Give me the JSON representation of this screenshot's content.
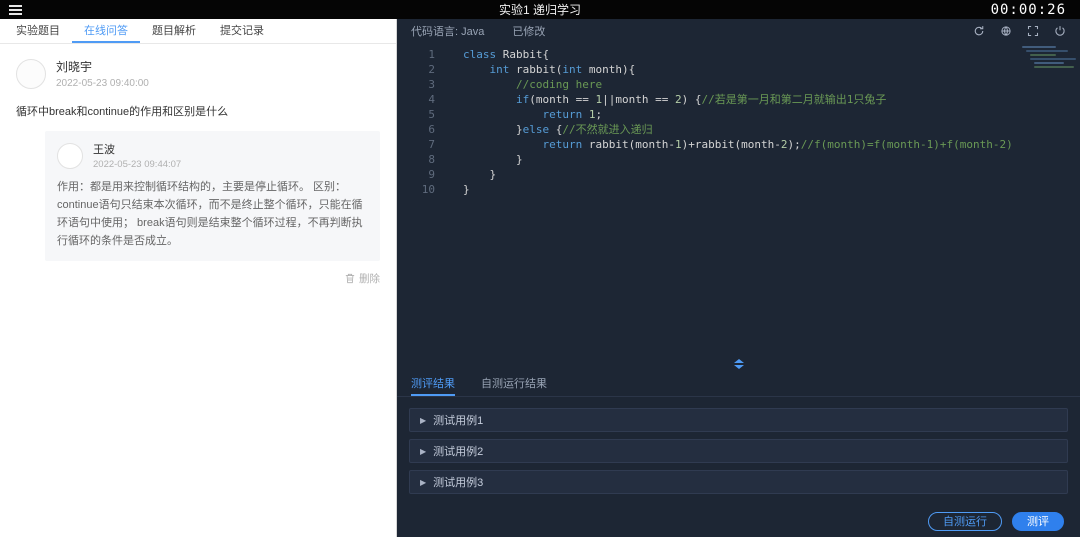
{
  "colors": {
    "accent": "#4f9bf5",
    "keyword": "#569cd6",
    "plain": "#d4d4d4",
    "comment": "#6a9955",
    "number": "#b5cea8"
  },
  "topbar": {
    "title": "实验1 递归学习",
    "timer": "00:00:26"
  },
  "left": {
    "tabs": [
      {
        "label": "实验题目"
      },
      {
        "label": "在线问答"
      },
      {
        "label": "题目解析"
      },
      {
        "label": "提交记录"
      }
    ],
    "active_tab": "在线问答",
    "question": {
      "author": "刘晓宇",
      "date": "2022-05-23 09:40:00",
      "text": "循环中break和continue的作用和区别是什么"
    },
    "reply": {
      "author": "王波",
      "date": "2022-05-23 09:44:07",
      "text": "作用：都是用来控制循环结构的，主要是停止循环。 区别： continue语句只结束本次循环，而不是终止整个循环，只能在循环语句中使用； break语句则是结束整个循环过程，不再判断执行循环的条件是否成立。"
    },
    "delete_label": "删除"
  },
  "editor": {
    "language_label": "代码语言: Java",
    "modified_label": "已修改",
    "lines": [
      [
        [
          "k",
          "class"
        ],
        [
          "p",
          " Rabbit{"
        ]
      ],
      [
        [
          "p",
          "    "
        ],
        [
          "k",
          "int"
        ],
        [
          "p",
          " rabbit("
        ],
        [
          "k",
          "int"
        ],
        [
          "p",
          " month){"
        ]
      ],
      [
        [
          "p",
          "        "
        ],
        [
          "c",
          "//coding here"
        ]
      ],
      [
        [
          "p",
          "        "
        ],
        [
          "k",
          "if"
        ],
        [
          "p",
          "(month == "
        ],
        [
          "n",
          "1"
        ],
        [
          "p",
          "||month == "
        ],
        [
          "n",
          "2"
        ],
        [
          "p",
          ") {"
        ],
        [
          "c",
          "//若是第一月和第二月就输出1只兔子"
        ]
      ],
      [
        [
          "p",
          "            "
        ],
        [
          "k",
          "return"
        ],
        [
          "p",
          " "
        ],
        [
          "n",
          "1"
        ],
        [
          "p",
          ";"
        ]
      ],
      [
        [
          "p",
          "        }"
        ],
        [
          "k",
          "else"
        ],
        [
          "p",
          " {"
        ],
        [
          "c",
          "//不然就进入递归"
        ]
      ],
      [
        [
          "p",
          "            "
        ],
        [
          "k",
          "return"
        ],
        [
          "p",
          " rabbit(month-"
        ],
        [
          "n",
          "1"
        ],
        [
          "p",
          ")+rabbit(month-"
        ],
        [
          "n",
          "2"
        ],
        [
          "p",
          ");"
        ],
        [
          "c",
          "//f(month)=f(month-1)+f(month-2)"
        ]
      ],
      [
        [
          "p",
          "        }"
        ]
      ],
      [
        [
          "p",
          "    }"
        ]
      ],
      [
        [
          "p",
          "}"
        ]
      ]
    ]
  },
  "results": {
    "tabs": [
      {
        "label": "测评结果"
      },
      {
        "label": "自测运行结果"
      }
    ],
    "active_tab": "测评结果",
    "cases": [
      {
        "label": "测试用例1"
      },
      {
        "label": "测试用例2"
      },
      {
        "label": "测试用例3"
      }
    ]
  },
  "actions": {
    "self_test_label": "自测运行",
    "evaluate_label": "测评"
  }
}
